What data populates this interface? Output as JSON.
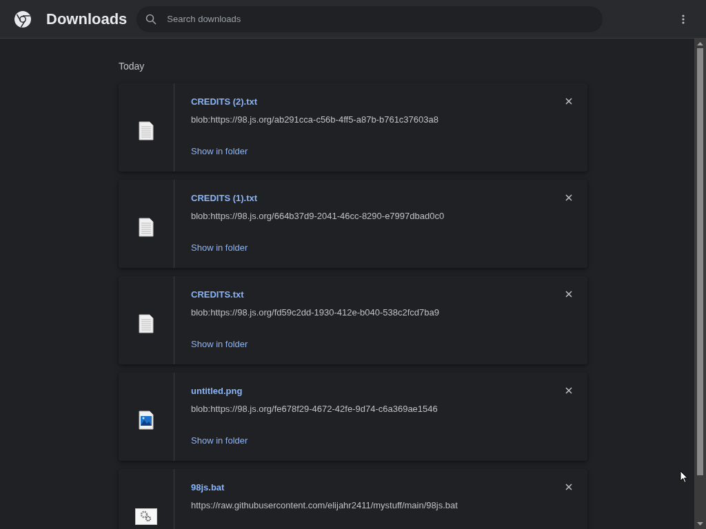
{
  "header": {
    "title": "Downloads",
    "search": {
      "placeholder": "Search downloads"
    }
  },
  "section": "Today",
  "items": [
    {
      "kind": "text",
      "name": "CREDITS (2).txt",
      "url": "blob:https://98.js.org/ab291cca-c56b-4ff5-a87b-b761c37603a8",
      "action": "Show in folder"
    },
    {
      "kind": "text",
      "name": "CREDITS (1).txt",
      "url": "blob:https://98.js.org/664b37d9-2041-46cc-8290-e7997dbad0c0",
      "action": "Show in folder"
    },
    {
      "kind": "text",
      "name": "CREDITS.txt",
      "url": "blob:https://98.js.org/fd59c2dd-1930-412e-b040-538c2fcd7ba9",
      "action": "Show in folder"
    },
    {
      "kind": "image",
      "name": "untitled.png",
      "url": "blob:https://98.js.org/fe678f29-4672-42fe-9d74-c6a369ae1546",
      "action": "Show in folder"
    },
    {
      "kind": "batch",
      "name": "98js.bat",
      "url": "https://raw.githubusercontent.com/elijahr2411/mystuff/main/98js.bat"
    }
  ]
}
